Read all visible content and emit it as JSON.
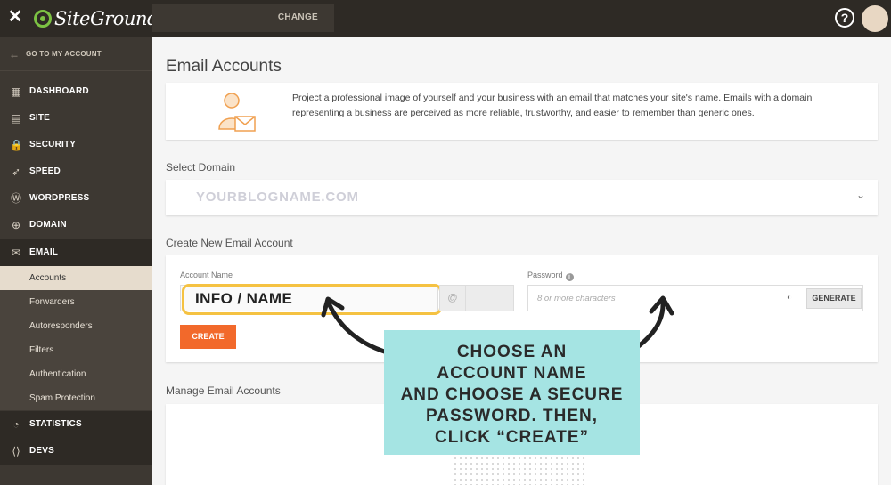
{
  "topbar": {
    "close": "✕",
    "logo": "SiteGround",
    "change_label": "CHANGE",
    "help": "?"
  },
  "sidebar": {
    "goto_account": "GO TO MY ACCOUNT",
    "items": [
      {
        "label": "DASHBOARD",
        "icon": "dashboard-icon",
        "glyph": "▦"
      },
      {
        "label": "SITE",
        "icon": "site-icon",
        "glyph": "▤"
      },
      {
        "label": "SECURITY",
        "icon": "lock-icon",
        "glyph": "🔒"
      },
      {
        "label": "SPEED",
        "icon": "rocket-icon",
        "glyph": "➶"
      },
      {
        "label": "WORDPRESS",
        "icon": "wordpress-icon",
        "glyph": "Ⓦ"
      },
      {
        "label": "DOMAIN",
        "icon": "globe-icon",
        "glyph": "⊕"
      },
      {
        "label": "EMAIL",
        "icon": "envelope-icon",
        "glyph": "✉"
      }
    ],
    "email_sub": [
      "Accounts",
      "Forwarders",
      "Autoresponders",
      "Filters",
      "Authentication",
      "Spam Protection"
    ],
    "bottom_items": [
      {
        "label": "STATISTICS",
        "icon": "statistics-icon",
        "glyph": "◔"
      },
      {
        "label": "DEVS",
        "icon": "code-icon",
        "glyph": "⟨⟩"
      }
    ]
  },
  "main": {
    "title": "Email Accounts",
    "intro": "Project a professional image of yourself and your business with an email that matches your site's name. Emails with a domain representing a business are perceived as more reliable, trustworthy, and easier to remember than generic ones.",
    "select_domain_label": "Select Domain",
    "domain_value": "YOURBLOGNAME.COM",
    "create_label": "Create New Email Account",
    "account_name_label": "Account Name",
    "account_name_value": "INFO / NAME",
    "at_sign": "@",
    "password_label": "Password",
    "password_placeholder": "8 or more characters",
    "generate_label": "GENERATE",
    "create_button": "CREATE",
    "manage_label": "Manage Email Accounts"
  },
  "callout": {
    "lines": [
      "CHOOSE AN",
      "ACCOUNT NAME",
      "AND CHOOSE A SECURE",
      "PASSWORD. THEN,",
      "CLICK “CREATE”"
    ]
  },
  "colors": {
    "sidebar_bg": "#3d3832",
    "topbar_bg": "#2e2a25",
    "create_button": "#f2692b",
    "highlight": "#f5c242",
    "callout_bg": "#a5e4e3"
  }
}
